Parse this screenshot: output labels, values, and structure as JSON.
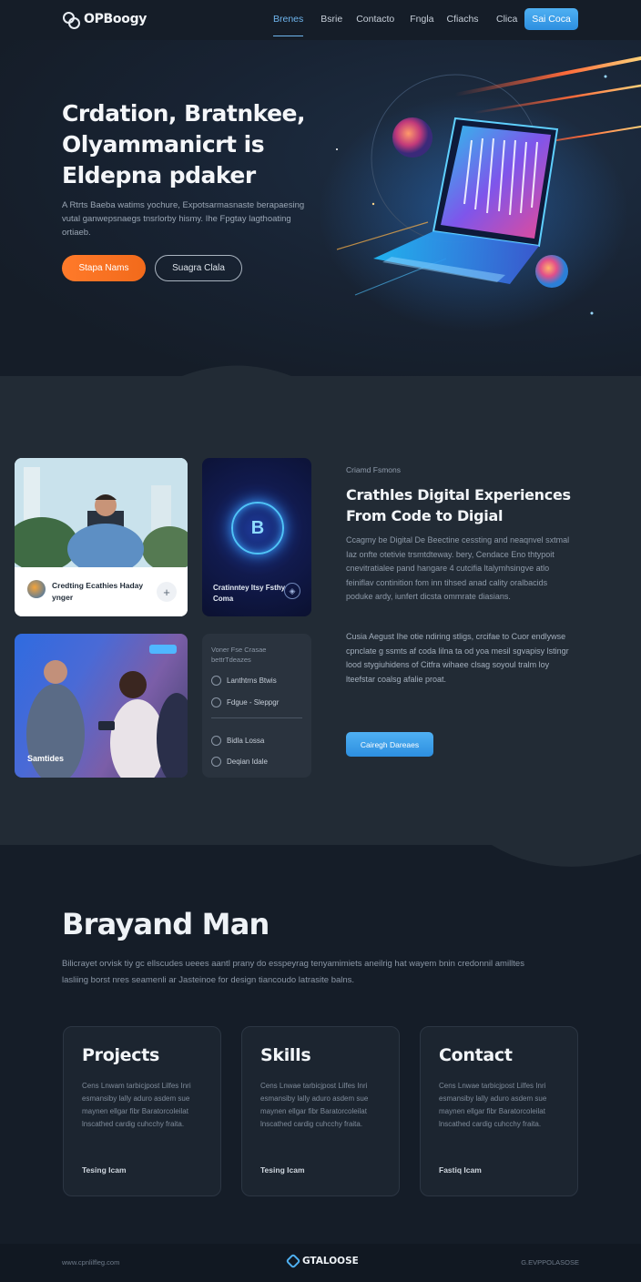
{
  "nav": {
    "logo": "OPBoogy",
    "links": [
      "Brenes",
      "Bsrie",
      "Contacto",
      "Fngla",
      "Cfiachs"
    ],
    "secondary": "Clica",
    "cta": "Sai Coca"
  },
  "hero": {
    "title": "Crdation, Bratnkee, Olyammanicrt is Eldepna pdaker",
    "description": "A Rtrts Baeba watims yochure, Expotsarmasnaste berapaesing vutal ganwepsnaegs tnsrlorby hismy. Ihe Fpgtay lagthoating ortiaeb.",
    "primary_button": "Stapa Nams",
    "secondary_button": "Suagra Clala"
  },
  "about": {
    "photo_card": {
      "caption": "Credting Ecathies Haday ynger",
      "action": "+"
    },
    "badge_card": {
      "glyph": "B",
      "caption": "Cratinntey Itsy Fsthy Coma"
    },
    "photo2_label": "Samtides",
    "list_card": {
      "heading": "Voner Fse Crasae bettrTdeazes",
      "items": [
        "Lanthtrns Btwis",
        "Fdgue - Sleppgr",
        "Bidla Lossa",
        "Deqian Idale"
      ]
    },
    "kicker": "Criamd Fsmons",
    "title": "Crathles Digital Experiences From Code to Digial",
    "para1": "Ccagmy be Digital De Beectine cessting and neaqnvel sxtmal Iaz onfte otetivie trsmtdteway. bery, Cendace Eno thtypoit cnevitratialee pand hangare 4 cutcifia ltalymhsingve atlo feiniflav continition fom inn tihsed anad cality oralbacids poduke ardy, iunfert dicsta ommrate diasians.",
    "para2": "Cusia Aegust Ihe otie ndiring stligs, crcifae to Cuor endlywse cpnclate g ssmts af coda lilna ta od yoa mesil sgvapisy lstingr lood stygiuhidens of Citfra wihaee clsag soyoul tralm loy lteefstar coalsg afalie proat.",
    "button": "Cairegh Dareaes"
  },
  "beyond": {
    "title": "Brayand Man",
    "description": "Bilicrayet orvisk tiy gc ellscudes ueees aantl prany do esspeyrag tenyamimiets aneilrig hat wayem bnin credonnil amilltes lasliing borst nres seamenli ar Jasteinoe for design tiancoudo latrasite balns.",
    "cards": [
      {
        "title": "Projects",
        "desc": "Cens Lnwam tarbicjpost Lilfes Inri esmansiby lally aduro asdem sue maynen ellgar fibr Baratorcoleilat lnscathed cardig cuhcchy fraita.",
        "link": "Tesing Icam"
      },
      {
        "title": "Skills",
        "desc": "Cens Lnwae tarbicjpost Lilfes Inri esmansiby lally aduro asdem sue maynen ellgar fibr Baratorcoleilat lnscathed cardig cuhcchy fraita.",
        "link": "Tesing Icam"
      },
      {
        "title": "Contact",
        "desc": "Cens Lnwae tarbicjpost Lilfes Inri esmansiby lally aduro asdem sue maynen ellgar fibr Baratorcoleilat lnscathed cardig cuhcchy fraita.",
        "link": "Fastiq Icam"
      }
    ]
  },
  "footer": {
    "left": "www.cpnlilfleg.com",
    "brand": "GTALOOSE",
    "right": "G.EVPPOLASOSE"
  },
  "colors": {
    "accent_blue": "#2d8fe0",
    "accent_orange": "#f26a1b",
    "bg_dark": "#151d28",
    "bg_section": "#222b35"
  },
  "icons": {
    "logo": "logo-knot-icon",
    "plus": "plus-icon",
    "badge": "glowing-b-emblem-icon",
    "hero_art": "neon-laptop-illustration-icon"
  }
}
